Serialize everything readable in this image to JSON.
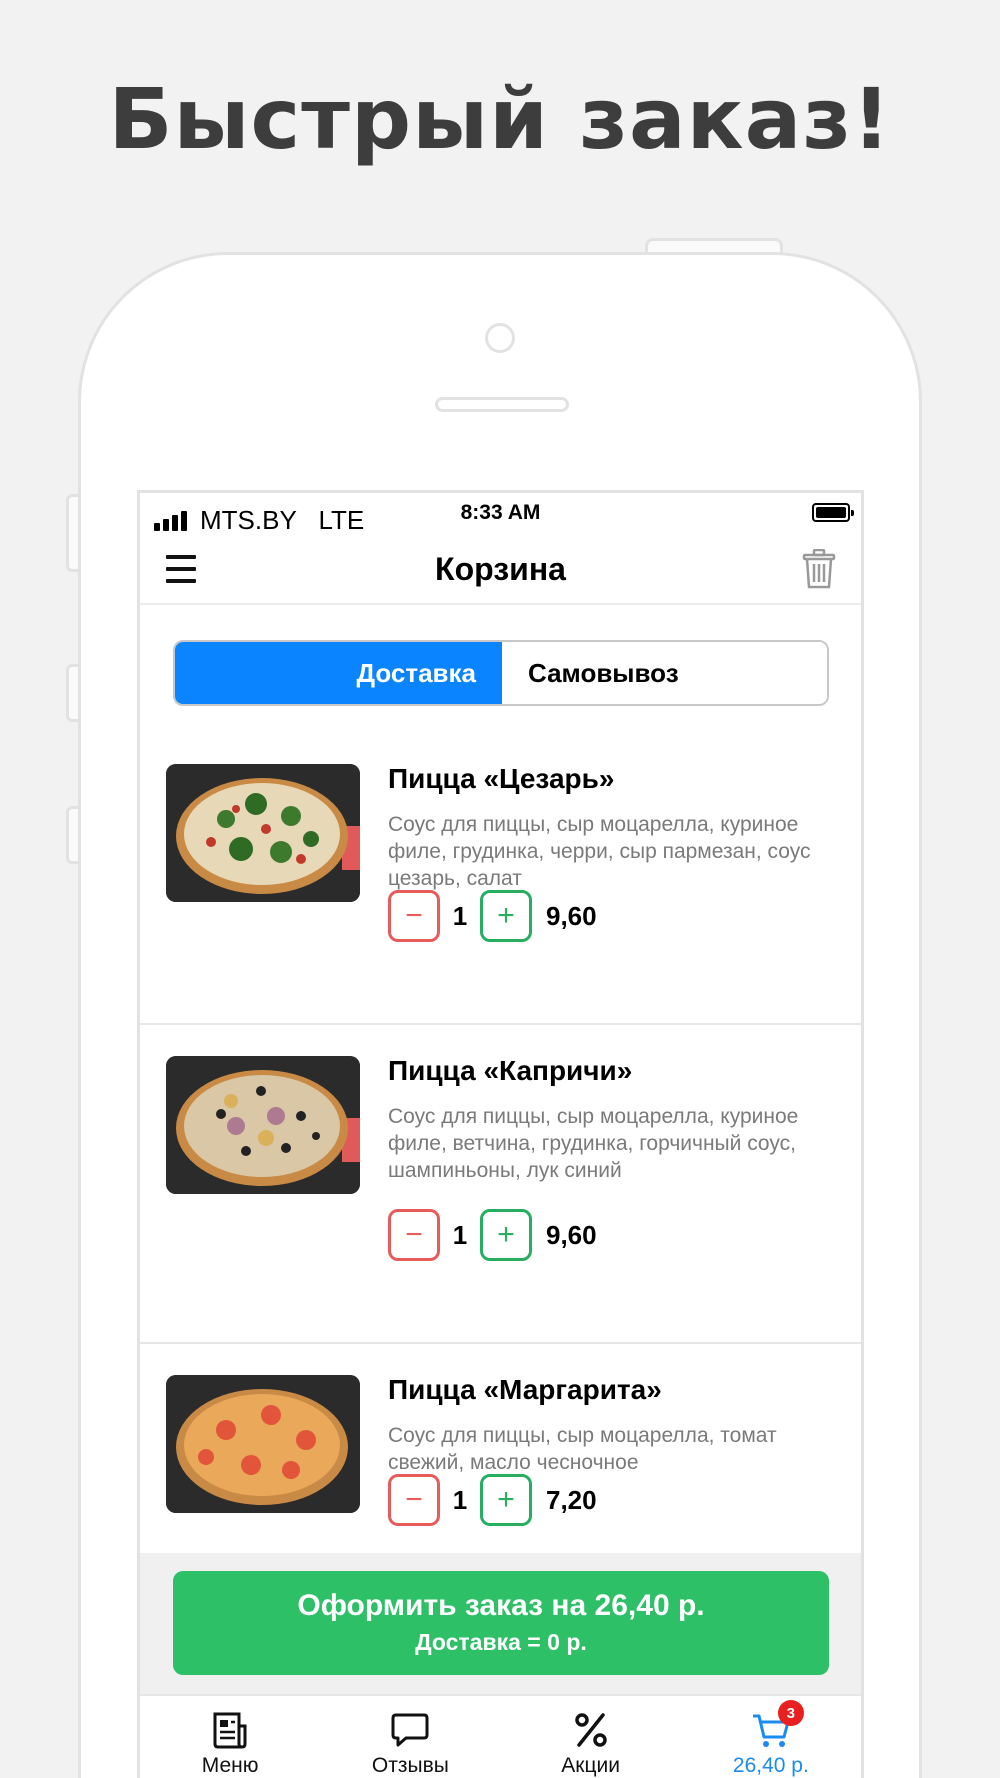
{
  "headline": "Быстрый заказ!",
  "status_bar": {
    "carrier": "MTS.BY",
    "network": "LTE",
    "time": "8:33 AM"
  },
  "nav": {
    "title": "Корзина",
    "menu_icon": "hamburger-menu-icon",
    "trash_icon": "trash-icon"
  },
  "delivery_toggle": {
    "options": [
      "Доставка",
      "Самовывоз"
    ],
    "selected": "Доставка"
  },
  "cart_items": [
    {
      "name": "Пицца «Цезарь»",
      "description": "Соус для пиццы, сыр моцарелла, куриное филе, грудинка, черри, сыр пармезан, соус цезарь, салат",
      "quantity": "1",
      "price": "9,60",
      "minus": "−",
      "plus": "+"
    },
    {
      "name": "Пицца «Капричи»",
      "description": "Соус для пиццы, сыр моцарелла, куриное филе, ветчина, грудинка, горчичный соус, шампиньоны, лук синий",
      "quantity": "1",
      "price": "9,60",
      "minus": "−",
      "plus": "+"
    },
    {
      "name": "Пицца «Маргарита»",
      "description": "Соус для пиццы, сыр моцарелла, томат свежий, масло чесночное",
      "quantity": "1",
      "price": "7,20",
      "minus": "−",
      "plus": "+"
    }
  ],
  "order_button": {
    "label": "Оформить заказ на 26,40 р.",
    "delivery": "Доставка = 0 р."
  },
  "tab_bar": [
    {
      "label": "Меню",
      "icon": "menu-document-icon"
    },
    {
      "label": "Отзывы",
      "icon": "chat-bubble-icon"
    },
    {
      "label": "Акции",
      "icon": "percent-icon"
    },
    {
      "label": "26,40 р.",
      "icon": "cart-icon",
      "badge": "3",
      "active": true
    }
  ],
  "colors": {
    "accent_blue": "#0a84ff",
    "order_green": "#2ec067",
    "minus_red": "#e65b5b",
    "plus_green": "#27ae60",
    "badge_red": "#e82020"
  }
}
